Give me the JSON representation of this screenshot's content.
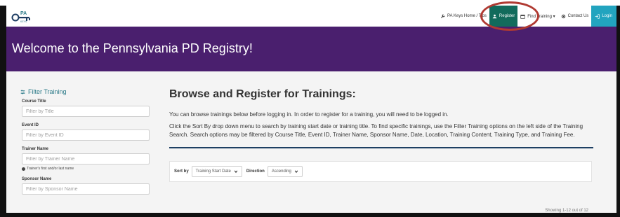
{
  "navbar": {
    "logo_text": "PA KEYS",
    "links": [
      {
        "icon": "wrench-icon",
        "label": "PA Keys Home / Tips"
      },
      {
        "icon": "user-icon",
        "label": "Register"
      },
      {
        "icon": "calendar-icon",
        "label": "Find Training ▾"
      },
      {
        "icon": "gear-icon",
        "label": "Contact Us"
      },
      {
        "icon": "login-icon",
        "label": "Login"
      }
    ],
    "colors": {
      "register_bg": "#126b5c",
      "login_bg": "#22a4bf"
    }
  },
  "banner": {
    "title": "Welcome to the Pennsylvania PD Registry!",
    "bg_color": "#4a1f6e"
  },
  "sidebar": {
    "heading": "Filter Training",
    "fields": [
      {
        "label": "Course Title",
        "placeholder": "Filter by Title"
      },
      {
        "label": "Event ID",
        "placeholder": "Filter by Event ID"
      },
      {
        "label": "Trainer Name",
        "placeholder": "Filter by Trainer Name",
        "hint": "Trainer's first and/or last name"
      },
      {
        "label": "Sponsor Name",
        "placeholder": "Filter by Sponsor Name"
      }
    ]
  },
  "main": {
    "title": "Browse and Register for Trainings:",
    "paragraph1": "You can browse trainings below before logging in. In order to register for a training, you will need to be logged in.",
    "paragraph2": "Click the Sort By drop down menu to search by training start date or training title. To find specific trainings, use the Filter Training options on the left side of the Training Search. Search options may be filtered by Course Title, Event ID, Trainer Name, Sponsor Name, Date, Location, Training Content, Training Type, and Training Fee.",
    "sort": {
      "sort_by_label": "Sort by",
      "sort_by_value": "Training Start Date",
      "direction_label": "Direction",
      "direction_value": "Ascending"
    },
    "showing": "Showing 1-12 out of 12"
  },
  "annotation": {
    "circle_color": "#b03a32"
  }
}
